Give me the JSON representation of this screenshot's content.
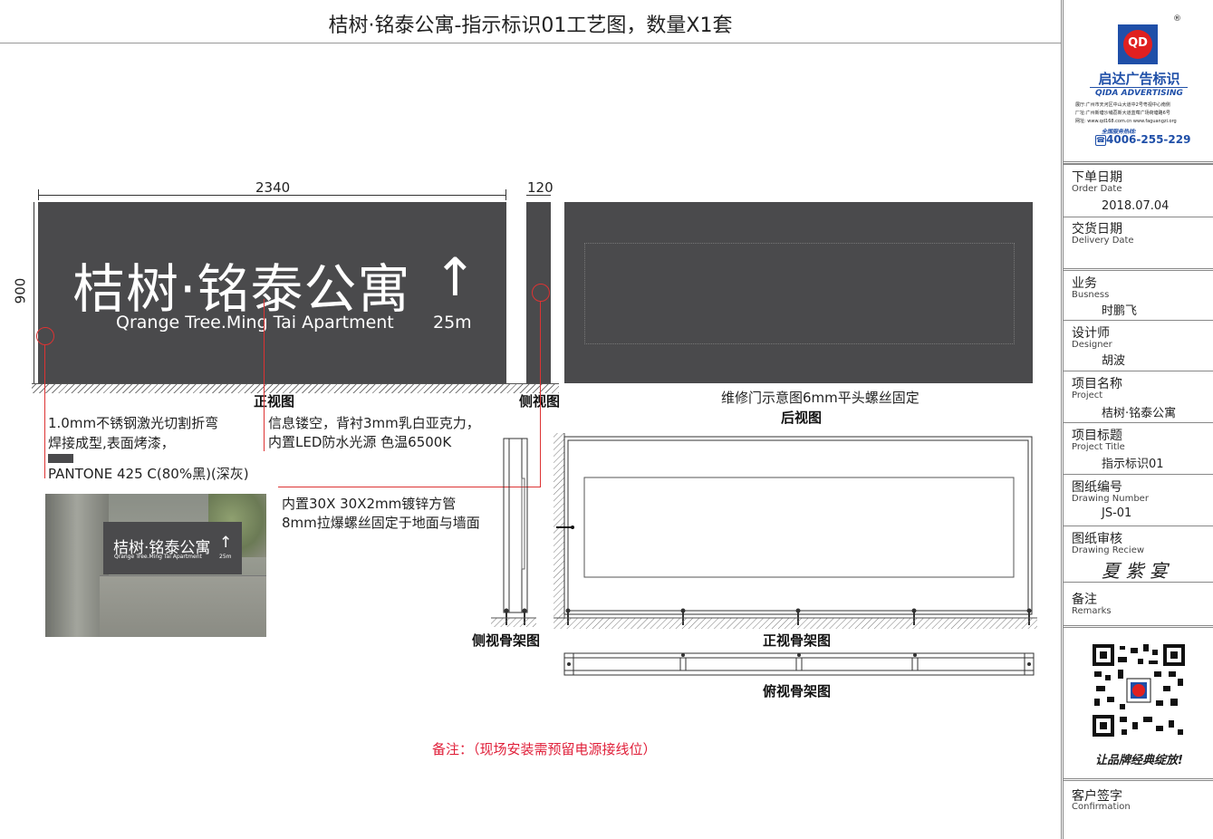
{
  "title": "桔树·铭泰公寓-指示标识01工艺图，数量X1套",
  "sign": {
    "name_cn": "桔树·铭泰公寓",
    "arrow": "↑",
    "name_en": "Qrange Tree.Ming Tai Apartment",
    "distance": "25m"
  },
  "dimensions": {
    "width": "2340",
    "height": "900",
    "depth": "120"
  },
  "views": {
    "front": "正视图",
    "side": "侧视图",
    "back": "后视图",
    "back_note": "维修门示意图6mm平头螺丝固定",
    "side_frame": "侧视骨架图",
    "front_frame": "正视骨架图",
    "top_frame": "俯视骨架图"
  },
  "notes": {
    "material_1": "1.0mm不锈钢激光切割折弯",
    "material_2": "焊接成型,表面烤漆，",
    "pantone": "PANTONE 425 C(80%黑)(深灰)",
    "led_1": "信息镂空，背衬3mm乳白亚克力，",
    "led_2": "内置LED防水光源 色温6500K",
    "pipe_1": "内置30X 30X2mm镀锌方管",
    "pipe_2": "8mm拉爆螺丝固定于地面与墙面",
    "remark": "备注：（现场安装需预留电源接线位）"
  },
  "photo": {
    "name_cn": "桔树·铭泰公寓",
    "arrow": "↑",
    "name_en": "Qrange Tree.Ming Tai Apartment",
    "distance": "25m"
  },
  "company": {
    "logo_letters": "QD",
    "name_cn": "启达广告标识",
    "name_en": "QIDA ADVERTISING",
    "addr_1": "展厅:广州市天河区中山大道中2号粤视中心南侧",
    "addr_2": "厂址:广州新塘沙埔荔新大道蓝莓广场荷塘路6号",
    "web": "网址: www.qd168.com.cn   www.faguangzi.org",
    "hotline_label": "全国服务热线:",
    "hotline": "4006-255-229",
    "slogan": "让品牌经典绽放!",
    "registered": "®"
  },
  "info": [
    {
      "cn": "下单日期",
      "en": "Order Date",
      "value": "2018.07.04"
    },
    {
      "cn": "交货日期",
      "en": "Delivery Date",
      "value": ""
    },
    {
      "cn": "业务",
      "en": "Busness",
      "value": "时鹏飞"
    },
    {
      "cn": "设计师",
      "en": "Designer",
      "value": "胡波"
    },
    {
      "cn": "项目名称",
      "en": "Project",
      "value": "桔树·铭泰公寓"
    },
    {
      "cn": "项目标题",
      "en": "Project Title",
      "value": "指示标识01"
    },
    {
      "cn": "图纸编号",
      "en": "Drawing Number",
      "value": "JS-01"
    },
    {
      "cn": "图纸审核",
      "en": "Drawing Reciew",
      "value": "夏 紫 宴"
    },
    {
      "cn": "备注",
      "en": "Remarks",
      "value": ""
    }
  ],
  "confirmation": {
    "cn": "客户签字",
    "en": "Confirmation"
  }
}
